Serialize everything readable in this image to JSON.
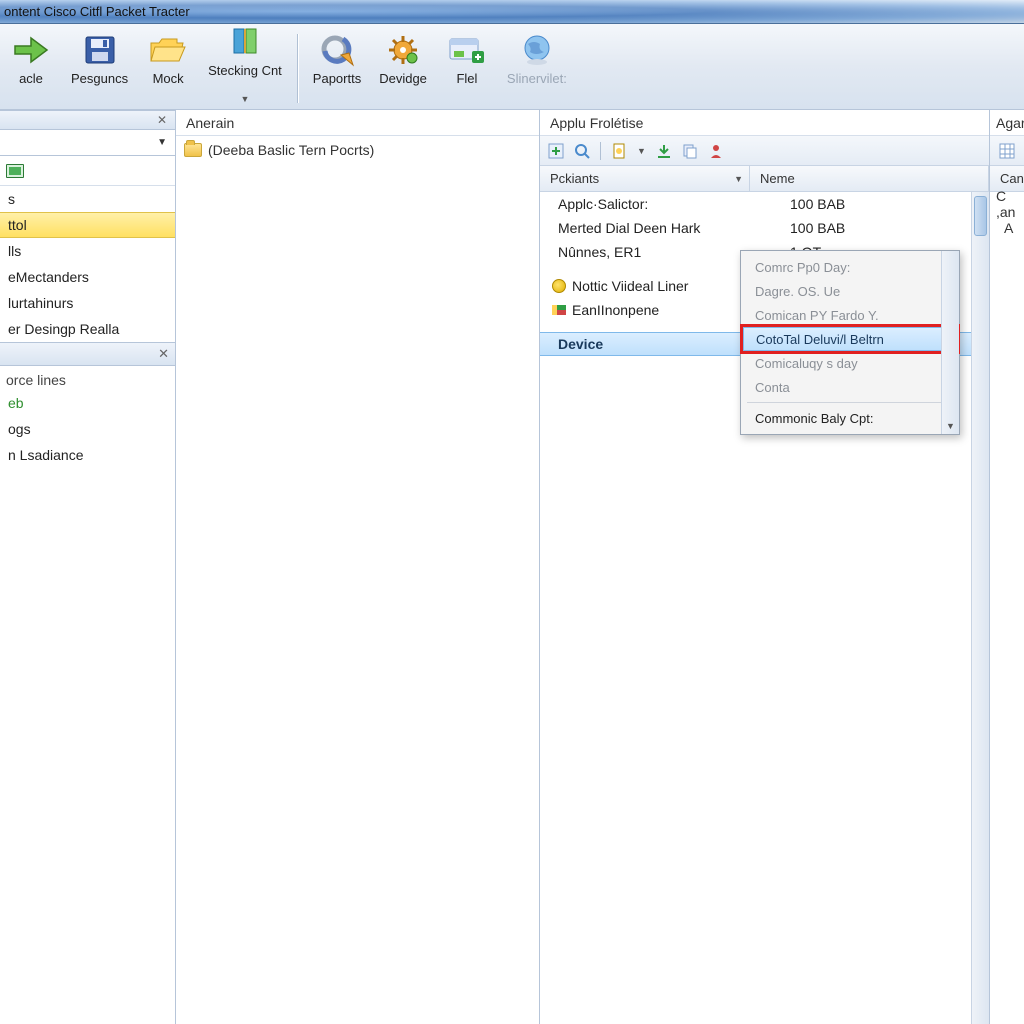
{
  "titlebar": {
    "text": "ontent Cisco Citfl Packet Tracter"
  },
  "toolbar": {
    "items": [
      {
        "label": "acle"
      },
      {
        "label": "Pesguncs"
      },
      {
        "label": "Mock"
      },
      {
        "label": "Stecking Cnt"
      },
      {
        "label": "Paportts"
      },
      {
        "label": "Devidge"
      },
      {
        "label": "Flel"
      },
      {
        "label": "Slinervilet:"
      }
    ]
  },
  "left": {
    "tree": [
      {
        "label": "s"
      },
      {
        "label": "ttol",
        "selected": true
      },
      {
        "label": "lls"
      },
      {
        "label": "eMectanders"
      },
      {
        "label": "lurtahinurs"
      },
      {
        "label": "er Desingp Realla"
      }
    ],
    "resources_title": "orce lines",
    "links": [
      {
        "label": "eb",
        "green": true
      },
      {
        "label": "ogs"
      },
      {
        "label": "n Lsadiance"
      }
    ]
  },
  "middle": {
    "title": "Anerain",
    "folder": "(Deeba Baslic Tern Pocrts)"
  },
  "right": {
    "title": "Applu Frolétise",
    "columns": {
      "c1": "Pckiants",
      "c2": "Neme"
    },
    "rows": [
      {
        "c1": "Applc·Salictor:",
        "c2": "100 BAB"
      },
      {
        "c1": "Merted Dial Deen Hark",
        "c2": "100 BAB"
      },
      {
        "c1": "Nûnnes, ER1",
        "c2": "1     OT"
      },
      {
        "c1": "Nottic Viideal Liner",
        "c2": "",
        "icon": "note"
      },
      {
        "c1": "EanIInonpene",
        "c2": "",
        "icon": "flag"
      },
      {
        "c1": "Device",
        "c2": "",
        "selected": true
      }
    ],
    "menu": [
      {
        "label": "Comrc Pp0 Day:"
      },
      {
        "label": "Dagre. OS. Ue"
      },
      {
        "label": "Comican PY Fardo Y."
      },
      {
        "label": "CotoTal Deluvi/l Beltrn",
        "highlight": true
      },
      {
        "label": "Comicaluqy s day"
      },
      {
        "label": "Conta"
      },
      {
        "label": "Commonic Baly Cpt:",
        "enabled": true,
        "sep_before": true
      }
    ]
  },
  "farright": {
    "title": "Agar",
    "header": "Can",
    "rows": [
      "C ,an",
      "A"
    ]
  }
}
